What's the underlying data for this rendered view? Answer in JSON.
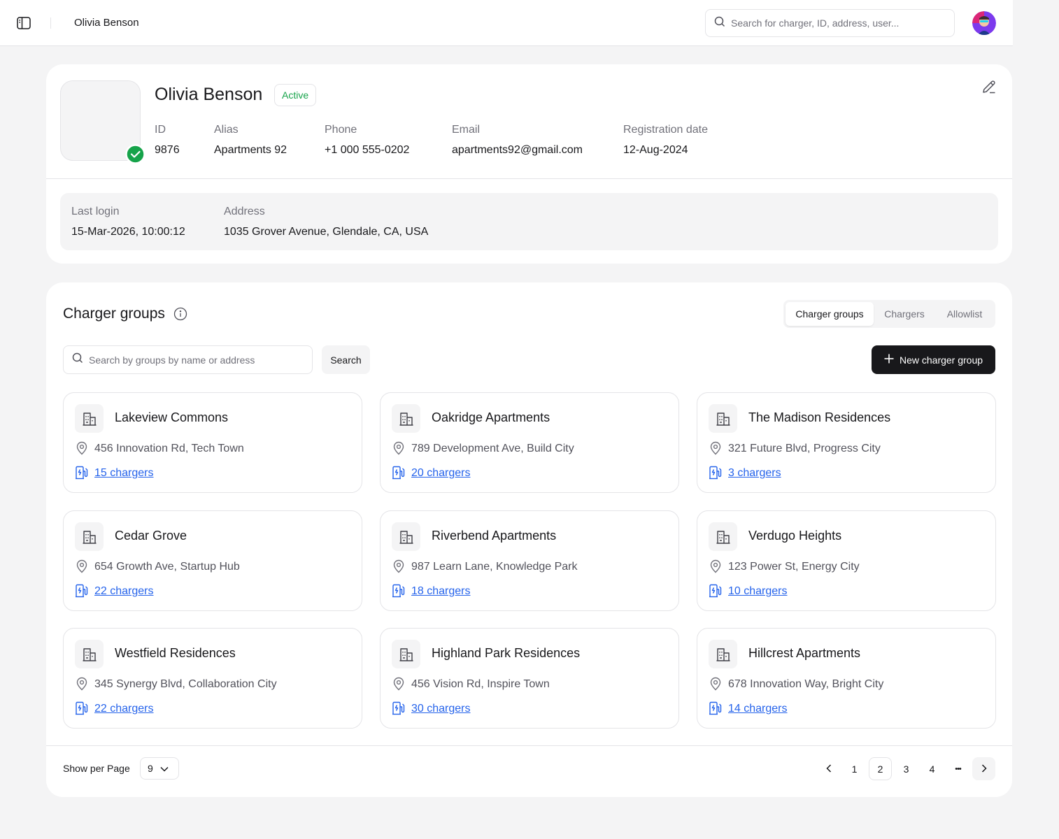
{
  "header": {
    "title": "Olivia Benson",
    "search_placeholder": "Search for charger, ID, address, user..."
  },
  "profile": {
    "name": "Olivia Benson",
    "status": "Active",
    "fields": [
      {
        "label": "ID",
        "value": "9876"
      },
      {
        "label": "Alias",
        "value": "Apartments 92"
      },
      {
        "label": "Phone",
        "value": "+1 000 555-0202"
      },
      {
        "label": "Email",
        "value": "apartments92@gmail.com"
      },
      {
        "label": "Registration date",
        "value": "12-Aug-2024"
      }
    ],
    "last_login": {
      "label": "Last login",
      "value": "15-Mar-2026, 10:00:12"
    },
    "address": {
      "label": "Address",
      "value": "1035 Grover Avenue, Glendale, CA, USA"
    }
  },
  "groups": {
    "title": "Charger groups",
    "tabs": [
      {
        "label": "Charger groups",
        "active": true
      },
      {
        "label": "Chargers",
        "active": false
      },
      {
        "label": "Allowlist",
        "active": false
      }
    ],
    "search_placeholder": "Search by groups by name or address",
    "search_button": "Search",
    "new_button": "New charger group",
    "items": [
      {
        "name": "Lakeview Commons",
        "address": "456 Innovation Rd, Tech Town",
        "chargers": "15 chargers"
      },
      {
        "name": "Oakridge Apartments",
        "address": "789 Development Ave, Build City",
        "chargers": "20 chargers"
      },
      {
        "name": "The Madison Residences",
        "address": "321 Future Blvd, Progress City",
        "chargers": "3 chargers"
      },
      {
        "name": "Cedar Grove",
        "address": "654 Growth Ave, Startup Hub",
        "chargers": "22 chargers"
      },
      {
        "name": "Riverbend Apartments",
        "address": "987 Learn Lane, Knowledge Park",
        "chargers": "18 chargers"
      },
      {
        "name": "Verdugo Heights",
        "address": "123 Power St, Energy City",
        "chargers": "10 chargers"
      },
      {
        "name": "Westfield Residences",
        "address": "345 Synergy Blvd, Collaboration City",
        "chargers": "22 chargers"
      },
      {
        "name": "Highland Park Residences",
        "address": "456 Vision Rd, Inspire Town",
        "chargers": "30 chargers"
      },
      {
        "name": "Hillcrest Apartments",
        "address": "678 Innovation Way, Bright City",
        "chargers": "14 chargers"
      }
    ]
  },
  "pagination": {
    "per_page_label": "Show per Page",
    "per_page_value": "9",
    "pages": [
      "1",
      "2",
      "3",
      "4"
    ],
    "current_page": "2",
    "ellipsis": "•••"
  },
  "colors": {
    "accent_link": "#2563eb",
    "status_green": "#16a34a",
    "primary_button": "#18181b",
    "background": "#f4f4f5"
  }
}
